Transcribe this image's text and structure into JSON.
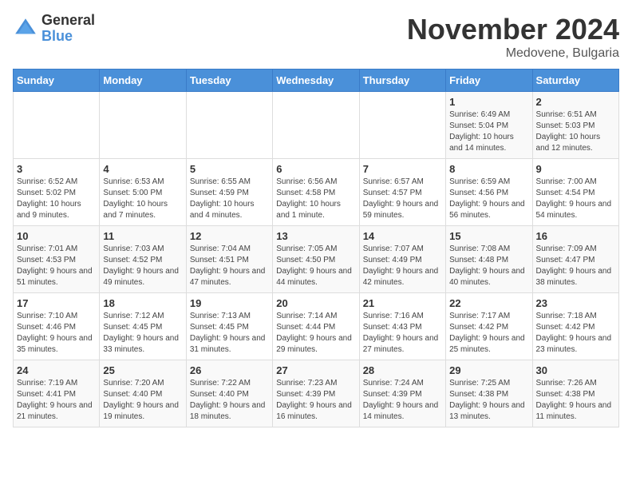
{
  "logo": {
    "general": "General",
    "blue": "Blue"
  },
  "title": "November 2024",
  "location": "Medovene, Bulgaria",
  "days_of_week": [
    "Sunday",
    "Monday",
    "Tuesday",
    "Wednesday",
    "Thursday",
    "Friday",
    "Saturday"
  ],
  "weeks": [
    [
      {
        "day": "",
        "info": ""
      },
      {
        "day": "",
        "info": ""
      },
      {
        "day": "",
        "info": ""
      },
      {
        "day": "",
        "info": ""
      },
      {
        "day": "",
        "info": ""
      },
      {
        "day": "1",
        "info": "Sunrise: 6:49 AM\nSunset: 5:04 PM\nDaylight: 10 hours and 14 minutes."
      },
      {
        "day": "2",
        "info": "Sunrise: 6:51 AM\nSunset: 5:03 PM\nDaylight: 10 hours and 12 minutes."
      }
    ],
    [
      {
        "day": "3",
        "info": "Sunrise: 6:52 AM\nSunset: 5:02 PM\nDaylight: 10 hours and 9 minutes."
      },
      {
        "day": "4",
        "info": "Sunrise: 6:53 AM\nSunset: 5:00 PM\nDaylight: 10 hours and 7 minutes."
      },
      {
        "day": "5",
        "info": "Sunrise: 6:55 AM\nSunset: 4:59 PM\nDaylight: 10 hours and 4 minutes."
      },
      {
        "day": "6",
        "info": "Sunrise: 6:56 AM\nSunset: 4:58 PM\nDaylight: 10 hours and 1 minute."
      },
      {
        "day": "7",
        "info": "Sunrise: 6:57 AM\nSunset: 4:57 PM\nDaylight: 9 hours and 59 minutes."
      },
      {
        "day": "8",
        "info": "Sunrise: 6:59 AM\nSunset: 4:56 PM\nDaylight: 9 hours and 56 minutes."
      },
      {
        "day": "9",
        "info": "Sunrise: 7:00 AM\nSunset: 4:54 PM\nDaylight: 9 hours and 54 minutes."
      }
    ],
    [
      {
        "day": "10",
        "info": "Sunrise: 7:01 AM\nSunset: 4:53 PM\nDaylight: 9 hours and 51 minutes."
      },
      {
        "day": "11",
        "info": "Sunrise: 7:03 AM\nSunset: 4:52 PM\nDaylight: 9 hours and 49 minutes."
      },
      {
        "day": "12",
        "info": "Sunrise: 7:04 AM\nSunset: 4:51 PM\nDaylight: 9 hours and 47 minutes."
      },
      {
        "day": "13",
        "info": "Sunrise: 7:05 AM\nSunset: 4:50 PM\nDaylight: 9 hours and 44 minutes."
      },
      {
        "day": "14",
        "info": "Sunrise: 7:07 AM\nSunset: 4:49 PM\nDaylight: 9 hours and 42 minutes."
      },
      {
        "day": "15",
        "info": "Sunrise: 7:08 AM\nSunset: 4:48 PM\nDaylight: 9 hours and 40 minutes."
      },
      {
        "day": "16",
        "info": "Sunrise: 7:09 AM\nSunset: 4:47 PM\nDaylight: 9 hours and 38 minutes."
      }
    ],
    [
      {
        "day": "17",
        "info": "Sunrise: 7:10 AM\nSunset: 4:46 PM\nDaylight: 9 hours and 35 minutes."
      },
      {
        "day": "18",
        "info": "Sunrise: 7:12 AM\nSunset: 4:45 PM\nDaylight: 9 hours and 33 minutes."
      },
      {
        "day": "19",
        "info": "Sunrise: 7:13 AM\nSunset: 4:45 PM\nDaylight: 9 hours and 31 minutes."
      },
      {
        "day": "20",
        "info": "Sunrise: 7:14 AM\nSunset: 4:44 PM\nDaylight: 9 hours and 29 minutes."
      },
      {
        "day": "21",
        "info": "Sunrise: 7:16 AM\nSunset: 4:43 PM\nDaylight: 9 hours and 27 minutes."
      },
      {
        "day": "22",
        "info": "Sunrise: 7:17 AM\nSunset: 4:42 PM\nDaylight: 9 hours and 25 minutes."
      },
      {
        "day": "23",
        "info": "Sunrise: 7:18 AM\nSunset: 4:42 PM\nDaylight: 9 hours and 23 minutes."
      }
    ],
    [
      {
        "day": "24",
        "info": "Sunrise: 7:19 AM\nSunset: 4:41 PM\nDaylight: 9 hours and 21 minutes."
      },
      {
        "day": "25",
        "info": "Sunrise: 7:20 AM\nSunset: 4:40 PM\nDaylight: 9 hours and 19 minutes."
      },
      {
        "day": "26",
        "info": "Sunrise: 7:22 AM\nSunset: 4:40 PM\nDaylight: 9 hours and 18 minutes."
      },
      {
        "day": "27",
        "info": "Sunrise: 7:23 AM\nSunset: 4:39 PM\nDaylight: 9 hours and 16 minutes."
      },
      {
        "day": "28",
        "info": "Sunrise: 7:24 AM\nSunset: 4:39 PM\nDaylight: 9 hours and 14 minutes."
      },
      {
        "day": "29",
        "info": "Sunrise: 7:25 AM\nSunset: 4:38 PM\nDaylight: 9 hours and 13 minutes."
      },
      {
        "day": "30",
        "info": "Sunrise: 7:26 AM\nSunset: 4:38 PM\nDaylight: 9 hours and 11 minutes."
      }
    ]
  ]
}
